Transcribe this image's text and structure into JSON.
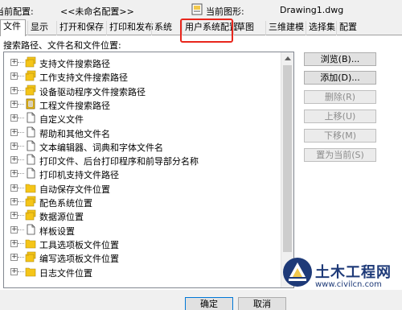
{
  "profile": {
    "current_profile_label": "当前配置:",
    "current_profile_value": "<<未命名配置>>",
    "current_drawing_label": "当前图形:",
    "current_drawing_value": "Drawing1.dwg"
  },
  "tabs": [
    {
      "label": "文件",
      "active": true
    },
    {
      "label": "显示"
    },
    {
      "label": "打开和保存"
    },
    {
      "label": "打印和发布"
    },
    {
      "label": "系统"
    },
    {
      "label": "用户系统配置",
      "highlighted": true
    },
    {
      "label": "草图"
    },
    {
      "label": "三维建模"
    },
    {
      "label": "选择集"
    },
    {
      "label": "配置"
    }
  ],
  "highlight_color": "#e8261c",
  "panel": {
    "title": "搜索路径、文件名和文件位置:",
    "tree_items": [
      {
        "label": "支持文件搜索路径",
        "icon": "folder-stack-icon"
      },
      {
        "label": "工作支持文件搜索路径",
        "icon": "folder-stack-icon"
      },
      {
        "label": "设备驱动程序文件搜索路径",
        "icon": "folder-stack-icon"
      },
      {
        "label": "工程文件搜索路径",
        "icon": "project-file-icon"
      },
      {
        "label": "自定义文件",
        "icon": "document-icon"
      },
      {
        "label": "帮助和其他文件名",
        "icon": "document-icon"
      },
      {
        "label": "文本编辑器、词典和字体文件名",
        "icon": "document-icon"
      },
      {
        "label": "打印文件、后台打印程序和前导部分名称",
        "icon": "document-icon"
      },
      {
        "label": "打印机支持文件路径",
        "icon": "document-icon"
      },
      {
        "label": "自动保存文件位置",
        "icon": "folder-icon"
      },
      {
        "label": "配色系统位置",
        "icon": "folder-stack-icon"
      },
      {
        "label": "数据源位置",
        "icon": "folder-stack-icon"
      },
      {
        "label": "样板设置",
        "icon": "document-icon"
      },
      {
        "label": "工具选项板文件位置",
        "icon": "folder-icon"
      },
      {
        "label": "编写选项板文件位置",
        "icon": "folder-stack-icon"
      },
      {
        "label": "日志文件位置",
        "icon": "folder-icon"
      }
    ]
  },
  "buttons": {
    "browse": "浏览(B)...",
    "add": "添加(D)...",
    "remove": "删除(R)",
    "move_up": "上移(U)",
    "move_down": "下移(M)",
    "set_current": "置为当前(S)"
  },
  "footer": {
    "ok": "确定",
    "cancel": "取消"
  },
  "watermark": {
    "title": "土木工程网",
    "url": "www.civilcn.com"
  },
  "colors": {
    "folder_yellow": "#f5c518",
    "brand_blue": "#1e3a78"
  }
}
